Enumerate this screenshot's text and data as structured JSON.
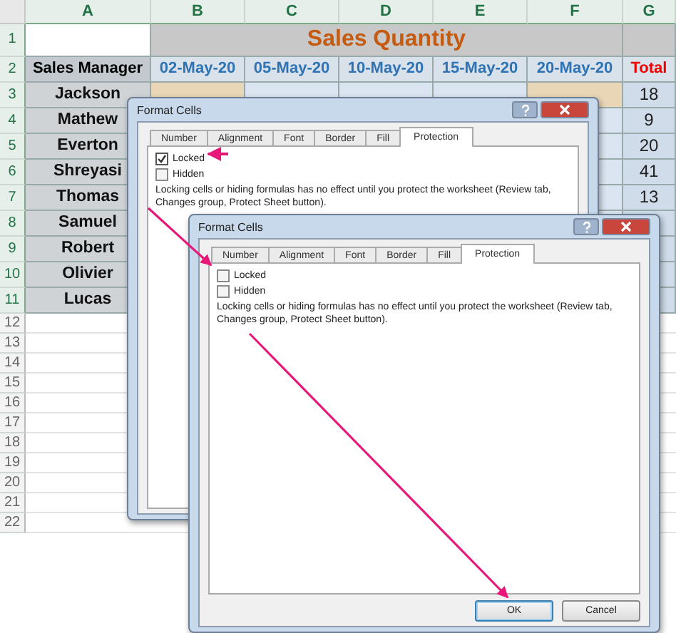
{
  "sheet": {
    "columns": [
      "A",
      "B",
      "C",
      "D",
      "E",
      "F",
      "G"
    ],
    "rows": [
      {
        "number": "1",
        "kind": "title",
        "title": "Sales Quantity"
      },
      {
        "number": "2",
        "kind": "header",
        "name": "Sales Manager",
        "dates": [
          "02-May-20",
          "05-May-20",
          "10-May-20",
          "15-May-20",
          "20-May-20"
        ],
        "total": "Total"
      },
      {
        "number": "3",
        "kind": "data",
        "name": "Jackson",
        "highlighted": true,
        "total": "18"
      },
      {
        "number": "4",
        "kind": "data",
        "name": "Mathew",
        "total": "9"
      },
      {
        "number": "5",
        "kind": "data",
        "name": "Everton",
        "total": "20"
      },
      {
        "number": "6",
        "kind": "data",
        "name": "Shreyasi",
        "total": "41"
      },
      {
        "number": "7",
        "kind": "data",
        "name": "Thomas",
        "total": "13"
      },
      {
        "number": "8",
        "kind": "data",
        "name": "Samuel"
      },
      {
        "number": "9",
        "kind": "data",
        "name": "Robert"
      },
      {
        "number": "10",
        "kind": "data",
        "name": "Olivier"
      },
      {
        "number": "11",
        "kind": "data",
        "name": "Lucas"
      },
      {
        "number": "12",
        "kind": "empty"
      },
      {
        "number": "13",
        "kind": "empty"
      },
      {
        "number": "14",
        "kind": "empty"
      },
      {
        "number": "15",
        "kind": "empty"
      },
      {
        "number": "16",
        "kind": "empty"
      },
      {
        "number": "17",
        "kind": "empty"
      },
      {
        "number": "18",
        "kind": "empty"
      },
      {
        "number": "19",
        "kind": "empty"
      },
      {
        "number": "20",
        "kind": "empty"
      },
      {
        "number": "21",
        "kind": "empty"
      },
      {
        "number": "22",
        "kind": "empty"
      }
    ]
  },
  "dialogs": [
    {
      "title": "Format Cells",
      "tabs": [
        {
          "label": "Number",
          "selected": false
        },
        {
          "label": "Alignment",
          "selected": false
        },
        {
          "label": "Font",
          "selected": false
        },
        {
          "label": "Border",
          "selected": false
        },
        {
          "label": "Fill",
          "selected": false
        },
        {
          "label": "Protection",
          "selected": true
        }
      ],
      "options": [
        {
          "label": "Locked",
          "checked": true
        },
        {
          "label": "Hidden",
          "checked": false
        }
      ],
      "note": "Locking cells or hiding formulas has no effect until you protect the worksheet (Review tab, Changes group, Protect Sheet button)."
    },
    {
      "title": "Format Cells",
      "tabs": [
        {
          "label": "Number",
          "selected": false
        },
        {
          "label": "Alignment",
          "selected": false
        },
        {
          "label": "Font",
          "selected": false
        },
        {
          "label": "Border",
          "selected": false
        },
        {
          "label": "Fill",
          "selected": false
        },
        {
          "label": "Protection",
          "selected": true
        }
      ],
      "options": [
        {
          "label": "Locked",
          "checked": false
        },
        {
          "label": "Hidden",
          "checked": false
        }
      ],
      "note": "Locking cells or hiding formulas has no effect until you protect the worksheet (Review tab, Changes group, Protect Sheet button).",
      "buttons": [
        {
          "label": "OK",
          "default": true
        },
        {
          "label": "Cancel",
          "default": false
        }
      ]
    }
  ]
}
